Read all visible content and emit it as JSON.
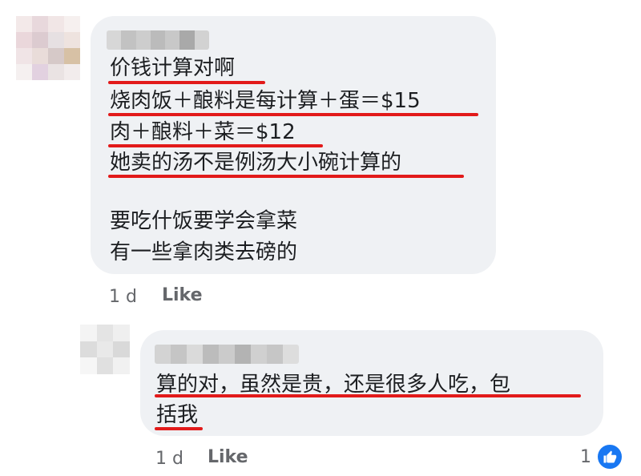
{
  "comment1": {
    "lines": [
      "价钱计算对啊",
      "烧肉饭＋酿料是每计算＋蛋＝$15",
      "肉＋酿料＋菜＝$12",
      "她卖的汤不是例汤大小碗计算的",
      "要吃什饭要学会拿菜",
      "有一些拿肉类去磅的"
    ],
    "time": "1 d",
    "like_label": "Like"
  },
  "comment2": {
    "lines": [
      "算的对，虽然是贵，还是很多人吃，包",
      "括我"
    ],
    "time": "1 d",
    "like_label": "Like",
    "reaction_count": "1"
  },
  "colors": {
    "bubble": "#eff1f4",
    "underline": "#e21a1a",
    "meta_text": "#65676b",
    "like_reaction": "#1877f2"
  },
  "icons": {
    "reaction": "thumbs-up-icon"
  }
}
